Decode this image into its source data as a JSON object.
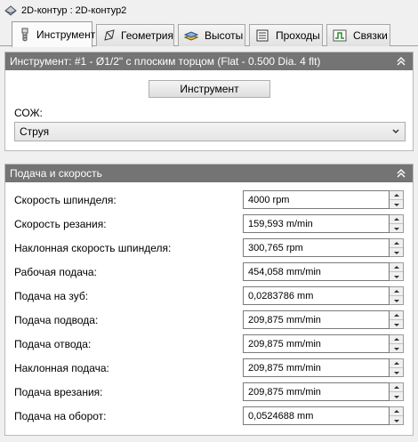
{
  "window": {
    "title": "2D-контур : 2D-контур2"
  },
  "tabs": [
    {
      "label": "Инструмент",
      "icon": "tool-icon"
    },
    {
      "label": "Геометрия",
      "icon": "geometry-icon"
    },
    {
      "label": "Высоты",
      "icon": "heights-icon"
    },
    {
      "label": "Проходы",
      "icon": "passes-icon"
    },
    {
      "label": "Связки",
      "icon": "linking-icon"
    }
  ],
  "tool_panel": {
    "header": "Инструмент: #1 - Ø1/2\" с плоским торцом (Flat - 0.500 Dia. 4 flt)",
    "tool_button": "Инструмент",
    "coolant_label": "СОЖ:",
    "coolant_value": "Струя"
  },
  "feed_panel": {
    "header": "Подача и скорость",
    "rows": [
      {
        "label": "Скорость шпинделя:",
        "value": "4000 rpm"
      },
      {
        "label": "Скорость резания:",
        "value": "159,593 m/min"
      },
      {
        "label": "Наклонная скорость шпинделя:",
        "value": "300,765 rpm"
      },
      {
        "label": "Рабочая подача:",
        "value": "454,058 mm/min"
      },
      {
        "label": "Подача на зуб:",
        "value": "0,0283786 mm"
      },
      {
        "label": "Подача подвода:",
        "value": "209,875 mm/min"
      },
      {
        "label": "Подача отвода:",
        "value": "209,875 mm/min"
      },
      {
        "label": "Наклонная подача:",
        "value": "209,875 mm/min"
      },
      {
        "label": "Подача врезания:",
        "value": "209,875 mm/min"
      },
      {
        "label": "Подача на оборот:",
        "value": "0,0524688 mm"
      }
    ]
  }
}
